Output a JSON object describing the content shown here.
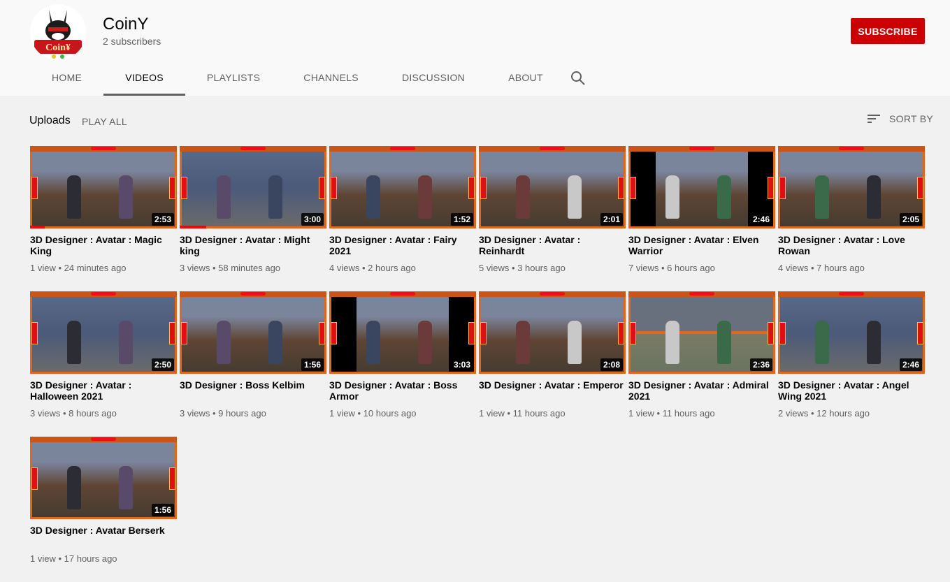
{
  "channel": {
    "name": "CoinY",
    "subscribers": "2 subscribers",
    "avatar_text": "Coin¥",
    "subscribe_label": "SUBSCRIBE"
  },
  "tabs": [
    {
      "label": "HOME",
      "active": false
    },
    {
      "label": "VIDEOS",
      "active": true
    },
    {
      "label": "PLAYLISTS",
      "active": false
    },
    {
      "label": "CHANNELS",
      "active": false
    },
    {
      "label": "DISCUSSION",
      "active": false
    },
    {
      "label": "ABOUT",
      "active": false
    }
  ],
  "uploads": {
    "title": "Uploads",
    "play_all": "PLAY ALL",
    "sort_by": "SORT BY"
  },
  "videos": [
    {
      "title": "3D Designer : Avatar : Magic King",
      "views": "1 view",
      "age": "24 minutes ago",
      "duration": "2:53",
      "watched_fraction": 0.1,
      "style": "normal"
    },
    {
      "title": "3D Designer : Avatar : Might king",
      "views": "3 views",
      "age": "58 minutes ago",
      "duration": "3:00",
      "watched_fraction": 0.18,
      "style": "alt"
    },
    {
      "title": "3D Designer : Avatar : Fairy 2021",
      "views": "4 views",
      "age": "2 hours ago",
      "duration": "1:52",
      "watched_fraction": 0,
      "style": "normal"
    },
    {
      "title": "3D Designer : Avatar : Reinhardt",
      "views": "5 views",
      "age": "3 hours ago",
      "duration": "2:01",
      "watched_fraction": 0,
      "style": "normal"
    },
    {
      "title": "3D Designer : Avatar : Elven Warrior",
      "views": "7 views",
      "age": "6 hours ago",
      "duration": "2:46",
      "watched_fraction": 0,
      "style": "letterbox"
    },
    {
      "title": "3D Designer : Avatar : Love Rowan",
      "views": "4 views",
      "age": "7 hours ago",
      "duration": "2:05",
      "watched_fraction": 0,
      "style": "normal"
    },
    {
      "title": "3D Designer : Avatar : Halloween 2021",
      "views": "3 views",
      "age": "8 hours ago",
      "duration": "2:50",
      "watched_fraction": 0,
      "style": "alt"
    },
    {
      "title": "3D Designer : Boss Kelbim",
      "views": "3 views",
      "age": "9 hours ago",
      "duration": "1:56",
      "watched_fraction": 0,
      "style": "normal"
    },
    {
      "title": "3D Designer : Avatar : Boss Armor",
      "views": "1 view",
      "age": "10 hours ago",
      "duration": "3:03",
      "watched_fraction": 0,
      "style": "letterbox"
    },
    {
      "title": "3D Designer : Avatar : Emperor",
      "views": "1 view",
      "age": "11 hours ago",
      "duration": "2:08",
      "watched_fraction": 0,
      "style": "normal"
    },
    {
      "title": "3D Designer : Avatar : Admiral 2021",
      "views": "1 view",
      "age": "11 hours ago",
      "duration": "2:36",
      "watched_fraction": 0,
      "style": "split"
    },
    {
      "title": "3D Designer : Avatar : Angel Wing 2021",
      "views": "2 views",
      "age": "12 hours ago",
      "duration": "2:46",
      "watched_fraction": 0,
      "style": "alt"
    },
    {
      "title": "3D Designer : Avatar Berserk",
      "views": "1 view",
      "age": "17 hours ago",
      "duration": "1:56",
      "watched_fraction": 0,
      "style": "normal"
    }
  ],
  "colors": {
    "subscribe": "#cc0000",
    "progress": "#ff0000",
    "thumb_frame": "#e2661c"
  }
}
